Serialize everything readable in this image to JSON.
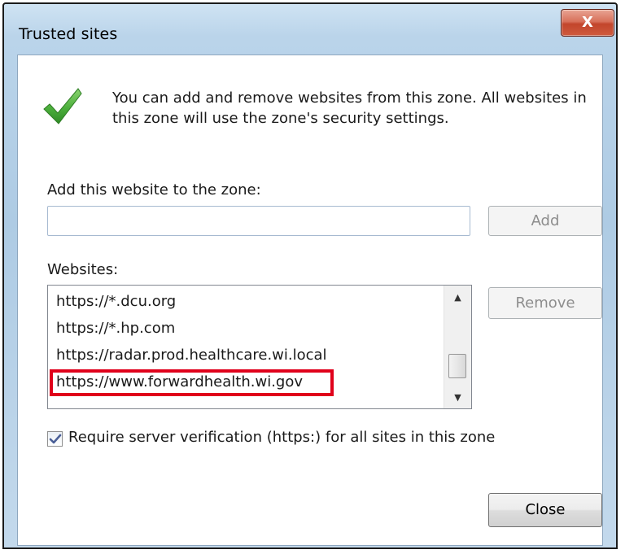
{
  "window": {
    "title": "Trusted sites",
    "close_glyph": "X"
  },
  "icons": {
    "info": "green-checkmark-icon",
    "close": "close-icon",
    "scroll_up": "scroll-up-arrow-icon",
    "scroll_down": "scroll-down-arrow-icon",
    "checkbox_mark": "checkmark-icon"
  },
  "intro_text": "You can add and remove websites from this zone. All websites in this zone will use the zone's security settings.",
  "add_section": {
    "label": "Add this website to the zone:",
    "input_value": "",
    "add_button": "Add"
  },
  "websites": {
    "label": "Websites:",
    "items": [
      "https://*.dcu.org",
      "https://*.hp.com",
      "https://radar.prod.healthcare.wi.local",
      "https://www.forwardhealth.wi.gov"
    ],
    "highlighted_index": 3,
    "remove_button": "Remove"
  },
  "scrollbar": {
    "up_glyph": "▲",
    "down_glyph": "▼"
  },
  "https_verification": {
    "checked": true,
    "label": "Require server verification (https:) for all sites in this zone"
  },
  "close_button": "Close",
  "colors": {
    "highlight_border": "#e0001b",
    "checkmark_green": "#4caf3c",
    "titlebar": "#bad4ea",
    "close_button": "#c2452b"
  }
}
